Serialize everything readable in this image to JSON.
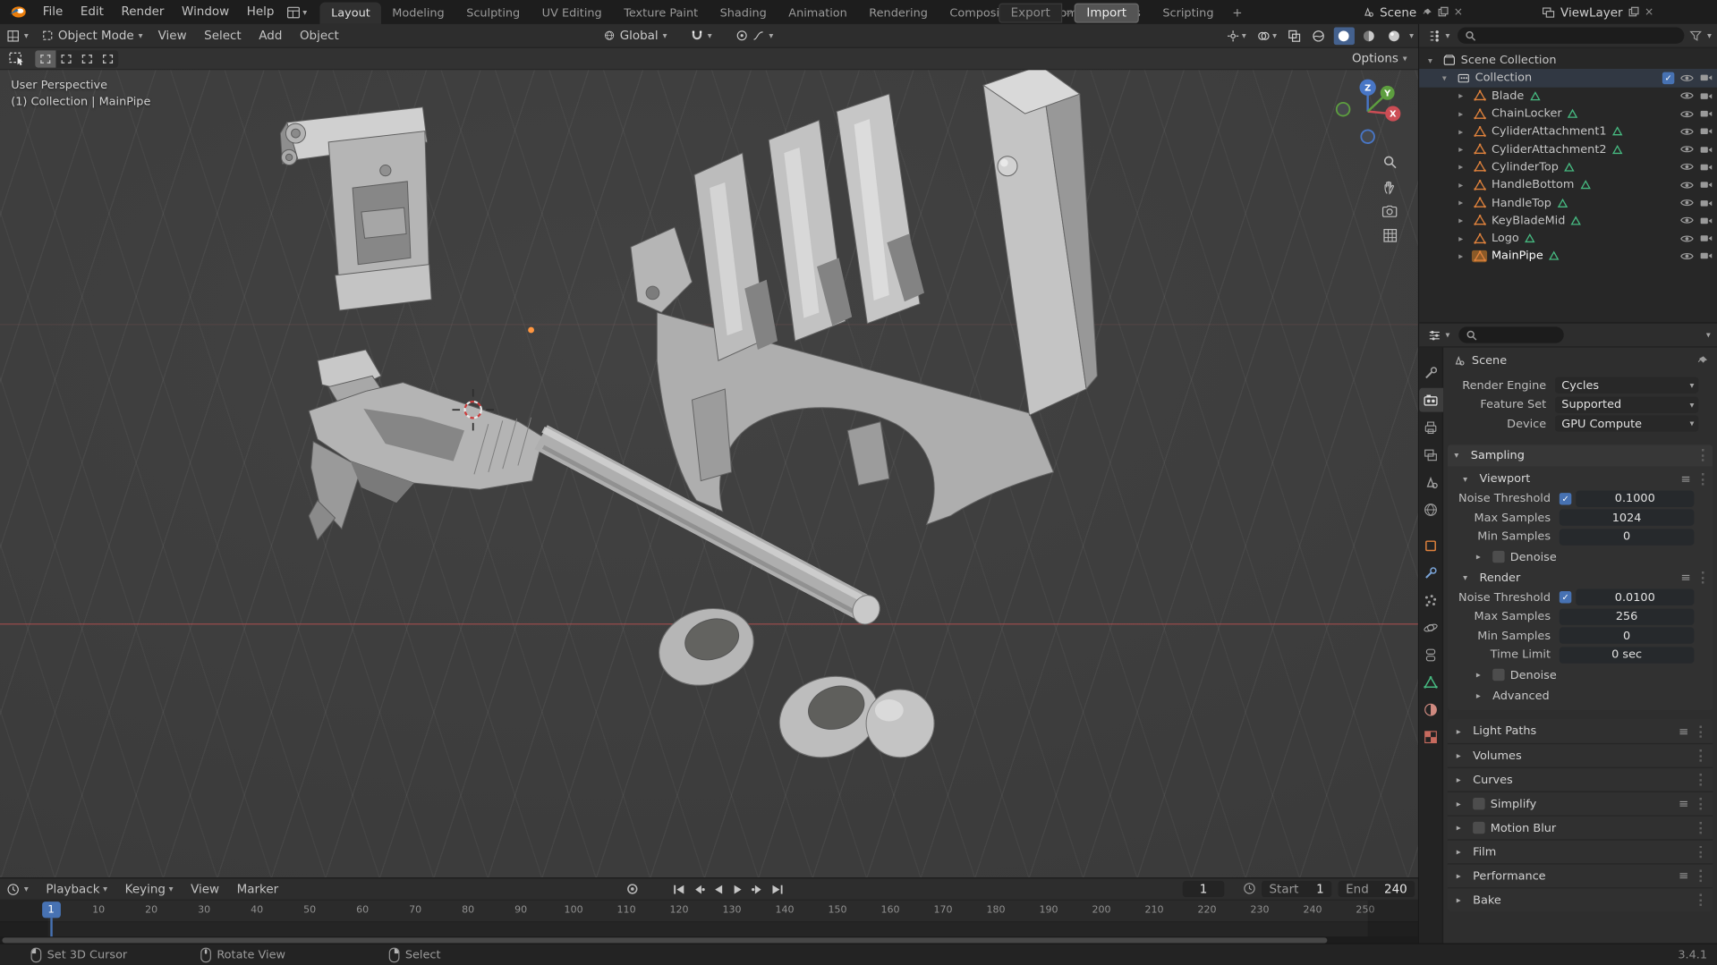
{
  "colors": {
    "accent": "#4772b3",
    "object-orange": "#e0823c",
    "data-green": "#46b980",
    "axis-x": "#cc4d55",
    "axis-y": "#5d9e3f",
    "axis-z": "#4876c6"
  },
  "topbar": {
    "menus": [
      "File",
      "Edit",
      "Render",
      "Window",
      "Help"
    ],
    "tabs": [
      {
        "label": "Layout",
        "active": true
      },
      {
        "label": "Modeling"
      },
      {
        "label": "Sculpting"
      },
      {
        "label": "UV Editing"
      },
      {
        "label": "Texture Paint"
      },
      {
        "label": "Shading"
      },
      {
        "label": "Animation"
      },
      {
        "label": "Rendering"
      },
      {
        "label": "Compositing"
      },
      {
        "label": "Geometry Nodes"
      },
      {
        "label": "Scripting"
      }
    ],
    "add_tab_label": "+",
    "export_label": "Export",
    "import_label": "Import",
    "scene_label": "Scene",
    "viewlayer_label": "ViewLayer"
  },
  "viewport": {
    "header": {
      "mode": "Object Mode",
      "menus": [
        "View",
        "Select",
        "Add",
        "Object"
      ],
      "orientation": "Global"
    },
    "tool_settings": {
      "options_label": "Options"
    },
    "overlay": {
      "perspective": "User Perspective",
      "context": "(1) Collection | MainPipe"
    },
    "gizmo": {
      "x": "X",
      "y": "Y",
      "z": "Z"
    }
  },
  "outliner": {
    "scene_collection_label": "Scene Collection",
    "collection_label": "Collection",
    "objects": [
      {
        "name": "Blade"
      },
      {
        "name": "ChainLocker"
      },
      {
        "name": "CyliderAttachment1"
      },
      {
        "name": "CyliderAttachment2"
      },
      {
        "name": "CylinderTop"
      },
      {
        "name": "HandleBottom"
      },
      {
        "name": "HandleTop"
      },
      {
        "name": "KeyBladeMid"
      },
      {
        "name": "Logo"
      },
      {
        "name": "MainPipe",
        "active": true
      }
    ]
  },
  "properties": {
    "tabs": [
      "tool",
      "render",
      "output",
      "view-layer",
      "scene",
      "world",
      "object",
      "modifiers",
      "particles",
      "physics",
      "constraints",
      "object-data",
      "material",
      "texture"
    ],
    "active_tab": "render",
    "breadcrumb": "Scene",
    "fields": [
      {
        "label": "Render Engine",
        "value": "Cycles"
      },
      {
        "label": "Feature Set",
        "value": "Supported"
      },
      {
        "label": "Device",
        "value": "GPU Compute"
      }
    ],
    "sampling": {
      "title": "Sampling",
      "viewport": {
        "title": "Viewport",
        "rows": [
          {
            "label": "Noise Threshold",
            "value": "0.1000",
            "checkbox": true,
            "checked": true
          },
          {
            "label": "Max Samples",
            "value": "1024"
          },
          {
            "label": "Min Samples",
            "value": "0"
          }
        ],
        "denoise_label": "Denoise"
      },
      "render": {
        "title": "Render",
        "rows": [
          {
            "label": "Noise Threshold",
            "value": "0.0100",
            "checkbox": true,
            "checked": true
          },
          {
            "label": "Max Samples",
            "value": "256"
          },
          {
            "label": "Min Samples",
            "value": "0"
          },
          {
            "label": "Time Limit",
            "value": "0 sec"
          }
        ],
        "denoise_label": "Denoise"
      },
      "advanced_label": "Advanced"
    },
    "panels": [
      {
        "label": "Light Paths",
        "menu": true
      },
      {
        "label": "Volumes"
      },
      {
        "label": "Curves"
      },
      {
        "label": "Simplify",
        "checkbox": true,
        "menu": true
      },
      {
        "label": "Motion Blur",
        "checkbox": true
      },
      {
        "label": "Film"
      },
      {
        "label": "Performance",
        "menu": true
      },
      {
        "label": "Bake"
      }
    ]
  },
  "timeline": {
    "menus": [
      "Playback",
      "Keying",
      "View",
      "Marker"
    ],
    "current_frame": "1",
    "playhead_frame": 1,
    "start": {
      "label": "Start",
      "value": "1"
    },
    "end": {
      "label": "End",
      "value": "240"
    },
    "ticks": [
      10,
      20,
      30,
      40,
      50,
      60,
      70,
      80,
      90,
      100,
      110,
      120,
      130,
      140,
      150,
      160,
      170,
      180,
      190,
      200,
      210,
      220,
      230,
      240,
      250
    ]
  },
  "statusbar": {
    "hints": [
      {
        "mouse": "left",
        "label": "Set 3D Cursor"
      },
      {
        "mouse": "middle",
        "label": "Rotate View"
      },
      {
        "mouse": "right",
        "label": "Select"
      }
    ],
    "version": "3.4.1"
  }
}
